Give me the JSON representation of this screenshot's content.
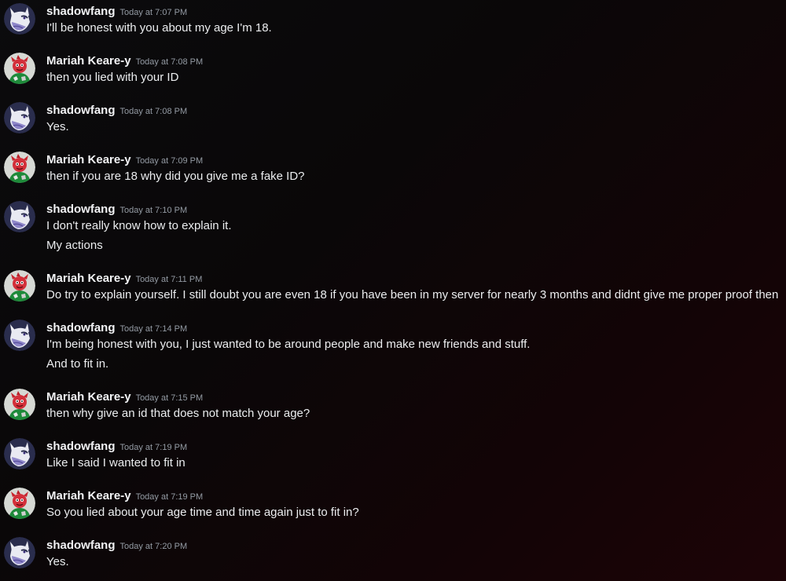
{
  "messages": [
    {
      "author": "shadowfang",
      "avatar": "wolf-avatar-icon",
      "time": "Today at 7:07 PM",
      "lines": [
        "I'll be honest with you about my age I'm 18."
      ]
    },
    {
      "author": "Mariah Keare-y",
      "avatar": "red-creature-avatar-icon",
      "time": "Today at 7:08 PM",
      "lines": [
        "then you lied with your ID"
      ]
    },
    {
      "author": "shadowfang",
      "avatar": "wolf-avatar-icon",
      "time": "Today at 7:08 PM",
      "lines": [
        "Yes."
      ]
    },
    {
      "author": "Mariah Keare-y",
      "avatar": "red-creature-avatar-icon",
      "time": "Today at 7:09 PM",
      "lines": [
        "then if you are 18 why did you give me a fake ID?"
      ]
    },
    {
      "author": "shadowfang",
      "avatar": "wolf-avatar-icon",
      "time": "Today at 7:10 PM",
      "lines": [
        "I don't really know how to explain it.",
        "My actions"
      ]
    },
    {
      "author": "Mariah Keare-y",
      "avatar": "red-creature-avatar-icon",
      "time": "Today at 7:11 PM",
      "lines": [
        "Do try to explain yourself. I still doubt you are even 18 if you have been in my server for nearly 3 months and didnt give me proper proof then"
      ]
    },
    {
      "author": "shadowfang",
      "avatar": "wolf-avatar-icon",
      "time": "Today at 7:14 PM",
      "lines": [
        "I'm being honest with you, I just wanted to be around people and make new friends and stuff.",
        "And to fit in."
      ]
    },
    {
      "author": "Mariah Keare-y",
      "avatar": "red-creature-avatar-icon",
      "time": "Today at 7:15 PM",
      "lines": [
        "then why give an id that does not match your age?"
      ]
    },
    {
      "author": "shadowfang",
      "avatar": "wolf-avatar-icon",
      "time": "Today at 7:19 PM",
      "lines": [
        "Like I said I wanted to fit in"
      ]
    },
    {
      "author": "Mariah Keare-y",
      "avatar": "red-creature-avatar-icon",
      "time": "Today at 7:19 PM",
      "lines": [
        "So you lied about your age time and time again just to fit in?"
      ]
    },
    {
      "author": "shadowfang",
      "avatar": "wolf-avatar-icon",
      "time": "Today at 7:20 PM",
      "lines": [
        "Yes."
      ]
    }
  ]
}
